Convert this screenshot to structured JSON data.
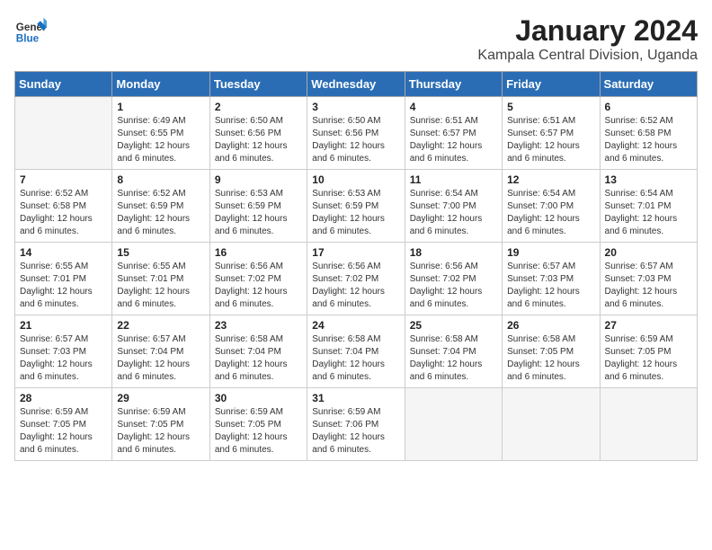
{
  "header": {
    "logo_text_general": "General",
    "logo_text_blue": "Blue",
    "month_year": "January 2024",
    "location": "Kampala Central Division, Uganda"
  },
  "days_of_week": [
    "Sunday",
    "Monday",
    "Tuesday",
    "Wednesday",
    "Thursday",
    "Friday",
    "Saturday"
  ],
  "weeks": [
    [
      {
        "day": "",
        "info": ""
      },
      {
        "day": "1",
        "info": "Sunrise: 6:49 AM\nSunset: 6:55 PM\nDaylight: 12 hours\nand 6 minutes."
      },
      {
        "day": "2",
        "info": "Sunrise: 6:50 AM\nSunset: 6:56 PM\nDaylight: 12 hours\nand 6 minutes."
      },
      {
        "day": "3",
        "info": "Sunrise: 6:50 AM\nSunset: 6:56 PM\nDaylight: 12 hours\nand 6 minutes."
      },
      {
        "day": "4",
        "info": "Sunrise: 6:51 AM\nSunset: 6:57 PM\nDaylight: 12 hours\nand 6 minutes."
      },
      {
        "day": "5",
        "info": "Sunrise: 6:51 AM\nSunset: 6:57 PM\nDaylight: 12 hours\nand 6 minutes."
      },
      {
        "day": "6",
        "info": "Sunrise: 6:52 AM\nSunset: 6:58 PM\nDaylight: 12 hours\nand 6 minutes."
      }
    ],
    [
      {
        "day": "7",
        "info": "Sunrise: 6:52 AM\nSunset: 6:58 PM\nDaylight: 12 hours\nand 6 minutes."
      },
      {
        "day": "8",
        "info": "Sunrise: 6:52 AM\nSunset: 6:59 PM\nDaylight: 12 hours\nand 6 minutes."
      },
      {
        "day": "9",
        "info": "Sunrise: 6:53 AM\nSunset: 6:59 PM\nDaylight: 12 hours\nand 6 minutes."
      },
      {
        "day": "10",
        "info": "Sunrise: 6:53 AM\nSunset: 6:59 PM\nDaylight: 12 hours\nand 6 minutes."
      },
      {
        "day": "11",
        "info": "Sunrise: 6:54 AM\nSunset: 7:00 PM\nDaylight: 12 hours\nand 6 minutes."
      },
      {
        "day": "12",
        "info": "Sunrise: 6:54 AM\nSunset: 7:00 PM\nDaylight: 12 hours\nand 6 minutes."
      },
      {
        "day": "13",
        "info": "Sunrise: 6:54 AM\nSunset: 7:01 PM\nDaylight: 12 hours\nand 6 minutes."
      }
    ],
    [
      {
        "day": "14",
        "info": "Sunrise: 6:55 AM\nSunset: 7:01 PM\nDaylight: 12 hours\nand 6 minutes."
      },
      {
        "day": "15",
        "info": "Sunrise: 6:55 AM\nSunset: 7:01 PM\nDaylight: 12 hours\nand 6 minutes."
      },
      {
        "day": "16",
        "info": "Sunrise: 6:56 AM\nSunset: 7:02 PM\nDaylight: 12 hours\nand 6 minutes."
      },
      {
        "day": "17",
        "info": "Sunrise: 6:56 AM\nSunset: 7:02 PM\nDaylight: 12 hours\nand 6 minutes."
      },
      {
        "day": "18",
        "info": "Sunrise: 6:56 AM\nSunset: 7:02 PM\nDaylight: 12 hours\nand 6 minutes."
      },
      {
        "day": "19",
        "info": "Sunrise: 6:57 AM\nSunset: 7:03 PM\nDaylight: 12 hours\nand 6 minutes."
      },
      {
        "day": "20",
        "info": "Sunrise: 6:57 AM\nSunset: 7:03 PM\nDaylight: 12 hours\nand 6 minutes."
      }
    ],
    [
      {
        "day": "21",
        "info": "Sunrise: 6:57 AM\nSunset: 7:03 PM\nDaylight: 12 hours\nand 6 minutes."
      },
      {
        "day": "22",
        "info": "Sunrise: 6:57 AM\nSunset: 7:04 PM\nDaylight: 12 hours\nand 6 minutes."
      },
      {
        "day": "23",
        "info": "Sunrise: 6:58 AM\nSunset: 7:04 PM\nDaylight: 12 hours\nand 6 minutes."
      },
      {
        "day": "24",
        "info": "Sunrise: 6:58 AM\nSunset: 7:04 PM\nDaylight: 12 hours\nand 6 minutes."
      },
      {
        "day": "25",
        "info": "Sunrise: 6:58 AM\nSunset: 7:04 PM\nDaylight: 12 hours\nand 6 minutes."
      },
      {
        "day": "26",
        "info": "Sunrise: 6:58 AM\nSunset: 7:05 PM\nDaylight: 12 hours\nand 6 minutes."
      },
      {
        "day": "27",
        "info": "Sunrise: 6:59 AM\nSunset: 7:05 PM\nDaylight: 12 hours\nand 6 minutes."
      }
    ],
    [
      {
        "day": "28",
        "info": "Sunrise: 6:59 AM\nSunset: 7:05 PM\nDaylight: 12 hours\nand 6 minutes."
      },
      {
        "day": "29",
        "info": "Sunrise: 6:59 AM\nSunset: 7:05 PM\nDaylight: 12 hours\nand 6 minutes."
      },
      {
        "day": "30",
        "info": "Sunrise: 6:59 AM\nSunset: 7:05 PM\nDaylight: 12 hours\nand 6 minutes."
      },
      {
        "day": "31",
        "info": "Sunrise: 6:59 AM\nSunset: 7:06 PM\nDaylight: 12 hours\nand 6 minutes."
      },
      {
        "day": "",
        "info": ""
      },
      {
        "day": "",
        "info": ""
      },
      {
        "day": "",
        "info": ""
      }
    ]
  ]
}
